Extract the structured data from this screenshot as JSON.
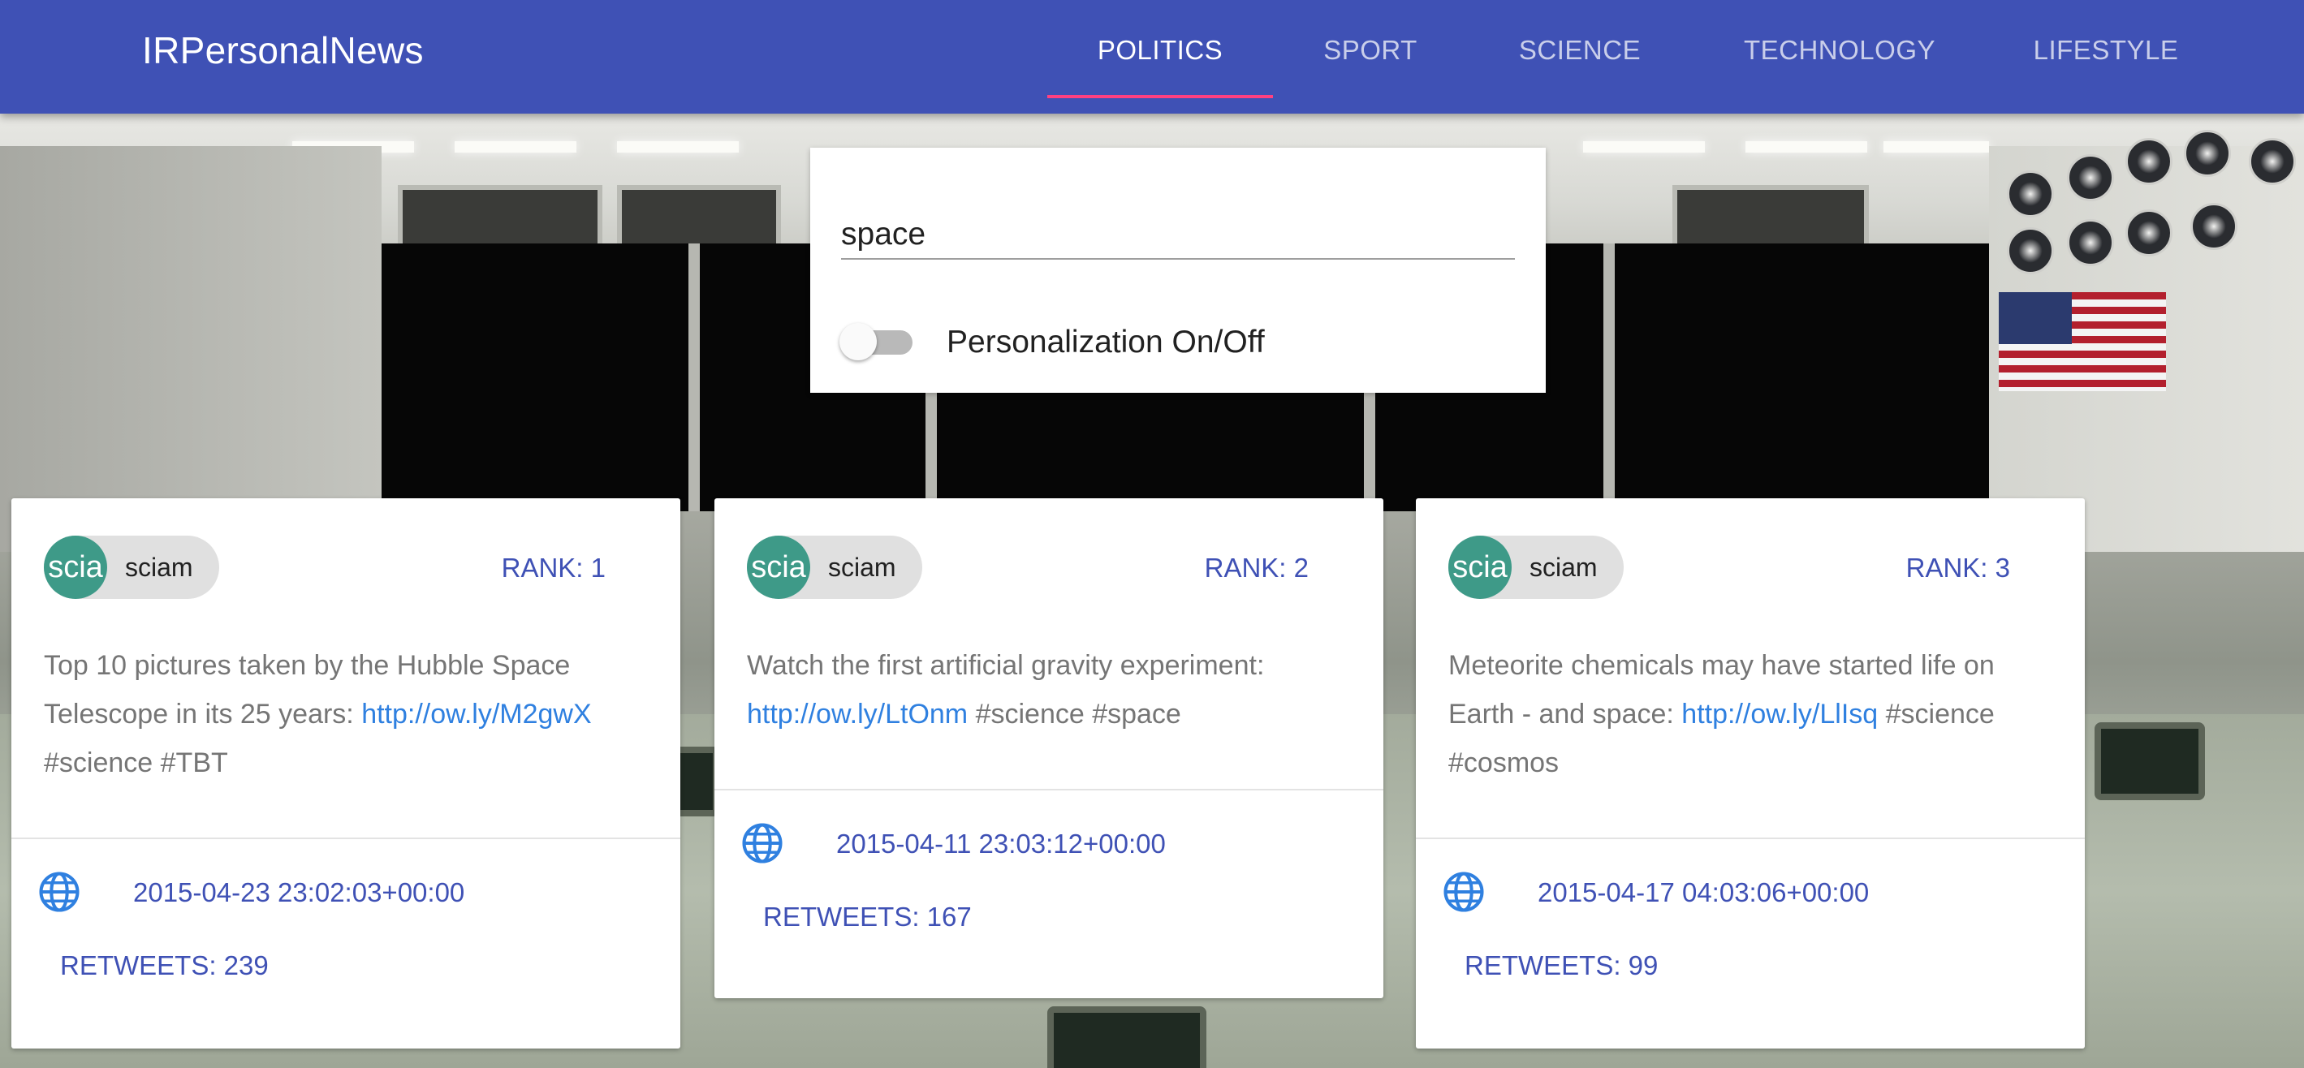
{
  "app": {
    "brand": "IRPersonalNews"
  },
  "nav": {
    "tabs": [
      {
        "label": "POLITICS",
        "active": true
      },
      {
        "label": "SPORT",
        "active": false
      },
      {
        "label": "SCIENCE",
        "active": false
      },
      {
        "label": "TECHNOLOGY",
        "active": false
      },
      {
        "label": "LIFESTYLE",
        "active": false
      }
    ]
  },
  "search": {
    "value": "space",
    "personalization_label": "Personalization On/Off",
    "personalization_on": false
  },
  "colors": {
    "appbar": "#3f51b5",
    "tab_indicator": "#ff4081",
    "avatar": "#3e9a88",
    "link": "#2f80e0"
  },
  "cards": [
    {
      "avatar_text": "scia",
      "source": "sciam",
      "rank": "RANK: 1",
      "text_before": "Top 10 pictures taken by the Hubble Space Telescope in its 25 years: ",
      "link": "http://ow.ly/M2gwX",
      "text_after": " #science #TBT",
      "date": "2015-04-23 23:02:03+00:00",
      "retweets": "RETWEETS: 239",
      "icon": "globe-icon"
    },
    {
      "avatar_text": "scia",
      "source": "sciam",
      "rank": "RANK: 2",
      "text_before": "Watch the first artificial gravity experiment: ",
      "link": "http://ow.ly/LtOnm",
      "text_after": " #science #space",
      "date": "2015-04-11 23:03:12+00:00",
      "retweets": "RETWEETS: 167",
      "icon": "globe-icon"
    },
    {
      "avatar_text": "scia",
      "source": "sciam",
      "rank": "RANK: 3",
      "text_before": "Meteorite chemicals may have started life on Earth - and space: ",
      "link": "http://ow.ly/LlIsq",
      "text_after": " #science #cosmos",
      "date": "2015-04-17 04:03:06+00:00",
      "retweets": "RETWEETS: 99",
      "icon": "globe-icon"
    }
  ]
}
